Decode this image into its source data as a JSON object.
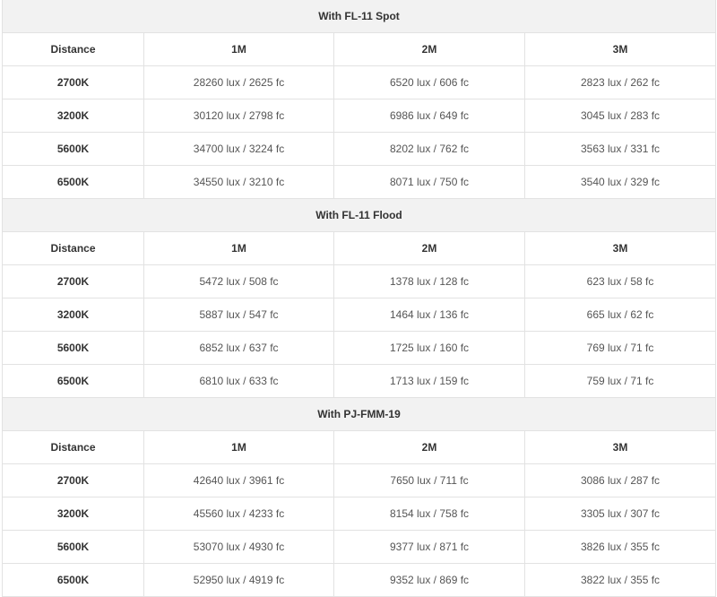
{
  "header_labels": {
    "distance": "Distance",
    "columns": [
      "1M",
      "2M",
      "3M"
    ]
  },
  "sections": [
    {
      "title": "With FL-11 Spot",
      "rows": [
        {
          "label": "2700K",
          "values": [
            "28260 lux / 2625 fc",
            "6520 lux / 606 fc",
            "2823 lux / 262 fc"
          ]
        },
        {
          "label": "3200K",
          "values": [
            "30120 lux / 2798 fc",
            "6986 lux / 649 fc",
            "3045 lux / 283 fc"
          ]
        },
        {
          "label": "5600K",
          "values": [
            "34700 lux / 3224 fc",
            "8202 lux / 762 fc",
            "3563 lux / 331 fc"
          ]
        },
        {
          "label": "6500K",
          "values": [
            "34550 lux / 3210 fc",
            "8071 lux / 750 fc",
            "3540 lux / 329 fc"
          ]
        }
      ]
    },
    {
      "title": "With FL-11 Flood",
      "rows": [
        {
          "label": "2700K",
          "values": [
            "5472 lux / 508 fc",
            "1378 lux / 128 fc",
            "623 lux / 58 fc"
          ]
        },
        {
          "label": "3200K",
          "values": [
            "5887 lux / 547 fc",
            "1464 lux / 136 fc",
            "665 lux / 62 fc"
          ]
        },
        {
          "label": "5600K",
          "values": [
            "6852 lux / 637 fc",
            "1725 lux / 160 fc",
            "769 lux / 71 fc"
          ]
        },
        {
          "label": "6500K",
          "values": [
            "6810 lux / 633 fc",
            "1713 lux / 159 fc",
            "759 lux / 71 fc"
          ]
        }
      ]
    },
    {
      "title": "With PJ-FMM-19",
      "rows": [
        {
          "label": "2700K",
          "values": [
            "42640 lux / 3961 fc",
            "7650 lux / 711 fc",
            "3086 lux / 287 fc"
          ]
        },
        {
          "label": "3200K",
          "values": [
            "45560 lux / 4233 fc",
            "8154 lux / 758 fc",
            "3305 lux / 307 fc"
          ]
        },
        {
          "label": "5600K",
          "values": [
            "53070 lux / 4930 fc",
            "9377 lux / 871 fc",
            "3826 lux / 355 fc"
          ]
        },
        {
          "label": "6500K",
          "values": [
            "52950 lux / 4919 fc",
            "9352 lux / 869 fc",
            "3822 lux / 355 fc"
          ]
        }
      ]
    }
  ],
  "colors": {
    "section_bg": "#f2f2f2",
    "border": "#e2e2e2",
    "text": "#333333",
    "value_text": "#555555"
  }
}
